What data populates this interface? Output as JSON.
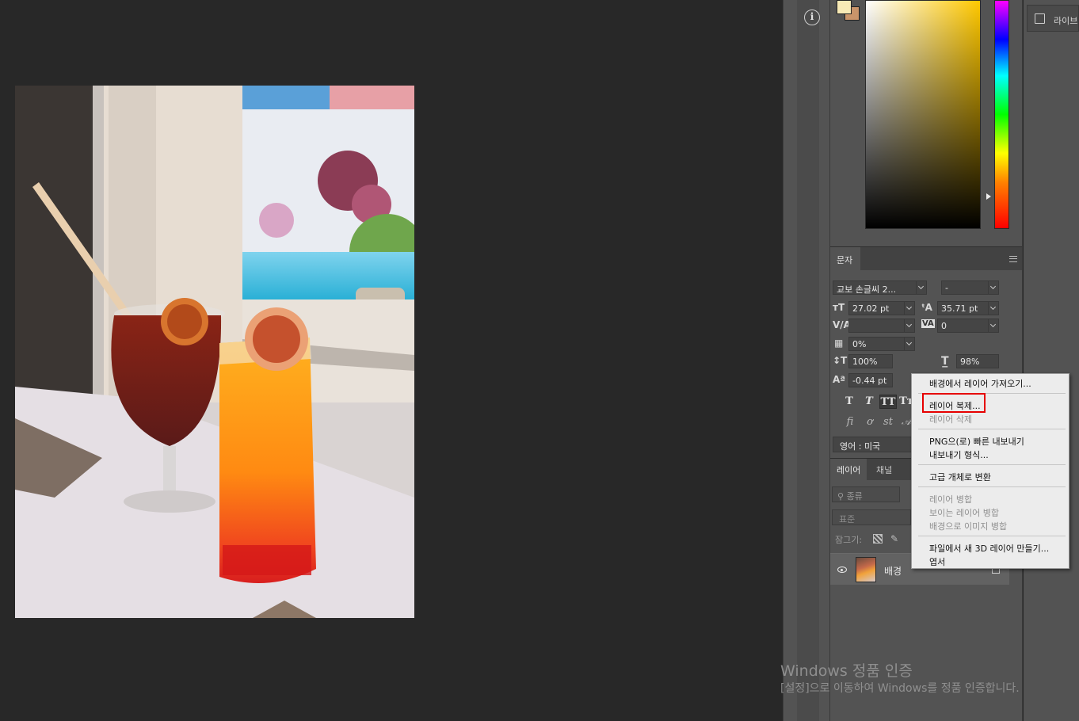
{
  "info_panel": {
    "icon": "info-icon",
    "glyph": "i"
  },
  "libraries_tab": {
    "label": "라이브"
  },
  "colors": {
    "foreground": "#f8eab6",
    "background": "#c9946a",
    "accent_highlight": "#e60000"
  },
  "character_panel": {
    "tab_label": "문자",
    "font_family": "교보 손글씨 2...",
    "font_style": "-",
    "font_size": "27.02 pt",
    "leading": "35.71 pt",
    "kerning": "",
    "tracking": "0",
    "tsume": "0%",
    "vertical_scale": "100%",
    "horizontal_scale": "98%",
    "baseline_shift": "-0.44 pt",
    "language": "영어 : 미국"
  },
  "layers_panel": {
    "tabs": [
      "레이어",
      "채널"
    ],
    "filter_placeholder": "종류",
    "blend_mode": "표준",
    "lock_label": "잠그기:",
    "layers": [
      {
        "name": "배경",
        "visible": true
      }
    ]
  },
  "context_menu": {
    "items": [
      {
        "label": "배경에서 레이어 가져오기...",
        "enabled": true
      },
      {
        "label": "레이어 복제...",
        "enabled": true,
        "highlighted": true
      },
      {
        "label": "레이어 삭제",
        "enabled": false
      },
      {
        "label": "PNG으(로) 빠른 내보내기",
        "enabled": true
      },
      {
        "label": "내보내기 형식...",
        "enabled": true
      },
      {
        "label": "고급 개체로 변환",
        "enabled": true
      },
      {
        "label": "레이어 병합",
        "enabled": false
      },
      {
        "label": "보이는 레이어 병합",
        "enabled": false
      },
      {
        "label": "배경으로 이미지 병합",
        "enabled": false
      },
      {
        "label": "파일에서 새 3D 레이어 만들기...",
        "enabled": true
      },
      {
        "label": "엽서",
        "enabled": true
      }
    ]
  },
  "watermark": {
    "title": "Windows 정품 인증",
    "subtitle": "[설정]으로 이동하여 Windows를 정품 인증합니다."
  }
}
